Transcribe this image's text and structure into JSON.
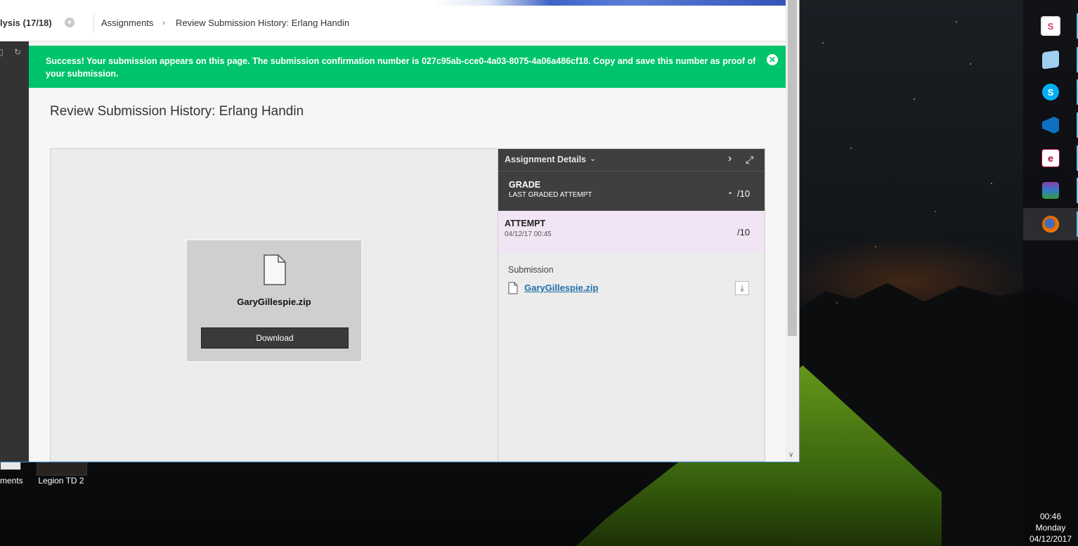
{
  "navbar": {
    "course_title": "lysis (17/18)",
    "breadcrumbs": [
      "Assignments",
      "Review Submission History: Erlang Handin"
    ],
    "crumb_separator": "›"
  },
  "banner": {
    "message": "Success! Your submission appears on this page. The submission confirmation number is 027c95ab-cce0-4a03-8075-4a06a486cf18. Copy and save this number as proof of your submission.",
    "close_icon": "close-icon",
    "color": "#00c46b"
  },
  "page": {
    "title": "Review Submission History: Erlang Handin"
  },
  "viewer": {
    "file_name": "GaryGillespie.zip",
    "download_label": "Download"
  },
  "details": {
    "header_label": "Assignment Details",
    "grade": {
      "label": "GRADE",
      "sublabel": "LAST GRADED ATTEMPT",
      "value": "-",
      "total": "/10"
    },
    "attempt": {
      "label": "ATTEMPT",
      "date": "04/12/17 00:45",
      "total": "/10"
    },
    "submission": {
      "label": "Submission",
      "file_name": "GaryGillespie.zip"
    }
  },
  "desktop": {
    "icons": [
      {
        "label": "ments"
      },
      {
        "label": "Legion TD 2"
      }
    ]
  },
  "taskbar": {
    "apps": [
      "slack-icon",
      "notepad-icon",
      "skype-icon",
      "visual-studio-icon",
      "erlang-icon",
      "winrar-icon",
      "firefox-icon"
    ],
    "active_app": "firefox-icon"
  },
  "clock": {
    "time": "00:46",
    "day": "Monday",
    "date": "04/12/2017"
  }
}
